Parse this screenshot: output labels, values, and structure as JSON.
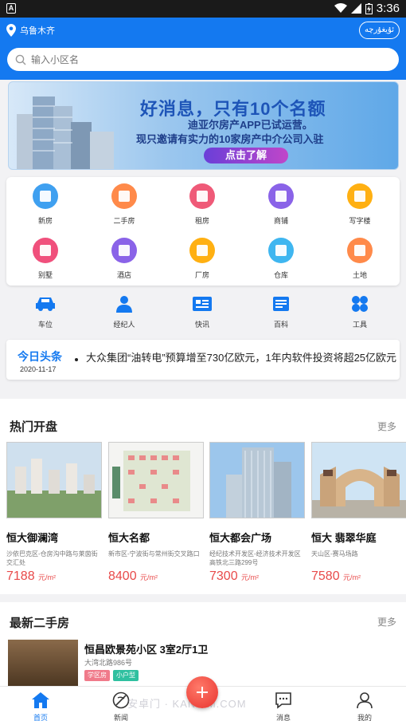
{
  "status": {
    "time": "3:36",
    "a_badge": "A"
  },
  "header": {
    "city": "乌鲁木齐",
    "lang_button": "ئۇيغۇرچە",
    "search_placeholder": "输入小区名"
  },
  "banner": {
    "title": "好消息，只有10个名额",
    "line1": "迪亚尔房产APP已试运营。",
    "line2": "现只邀请有实力的10家房产中介公司入驻",
    "button": "点击了解"
  },
  "categories": [
    {
      "label": "新房",
      "icon": "new-house-icon",
      "color": "#3fa0f0"
    },
    {
      "label": "二手房",
      "icon": "second-hand-house-icon",
      "color": "#ff8a4a"
    },
    {
      "label": "租房",
      "icon": "rent-icon",
      "color": "#ef5a78"
    },
    {
      "label": "商铺",
      "icon": "shop-icon",
      "color": "#8a63e8"
    },
    {
      "label": "写字楼",
      "icon": "office-icon",
      "color": "#ffb012"
    },
    {
      "label": "别墅",
      "icon": "villa-icon",
      "color": "#f0507c"
    },
    {
      "label": "酒店",
      "icon": "hotel-icon",
      "color": "#8a63e8"
    },
    {
      "label": "厂房",
      "icon": "factory-icon",
      "color": "#ffb012"
    },
    {
      "label": "仓库",
      "icon": "warehouse-icon",
      "color": "#3fb6f0"
    },
    {
      "label": "土地",
      "icon": "land-icon",
      "color": "#ff8a4a"
    }
  ],
  "tools": [
    {
      "label": "车位",
      "icon": "car-icon"
    },
    {
      "label": "经纪人",
      "icon": "agent-icon"
    },
    {
      "label": "快讯",
      "icon": "news-flash-icon"
    },
    {
      "label": "百科",
      "icon": "encyclopedia-icon"
    },
    {
      "label": "工具",
      "icon": "tools-icon"
    }
  ],
  "headline": {
    "title": "今日头条",
    "date": "2020-11-17",
    "news": "大众集团“油转电”预算增至730亿欧元，1年内软件投资将超25亿欧元"
  },
  "hot": {
    "title": "热门开盘",
    "more": "更多",
    "items": [
      {
        "name": "恒大御澜湾",
        "addr": "沙依巴克区-仓房沟中路与莱茵街交汇处",
        "price": "7188",
        "unit": "元/m²"
      },
      {
        "name": "恒大名都",
        "addr": "新市区-宁波街与常州街交叉路口",
        "price": "8400",
        "unit": "元/m²"
      },
      {
        "name": "恒大都会广场",
        "addr": "经纪技术开发区-经济技术开发区高铁北三路299号",
        "price": "7300",
        "unit": "元/m²"
      },
      {
        "name": "恒大 翡翠华庭",
        "addr": "天山区-赛马场路",
        "price": "7580",
        "unit": "元/m²"
      }
    ]
  },
  "second_hand": {
    "title": "最新二手房",
    "more": "更多",
    "item": {
      "title": "恒昌欧景苑小区  3室2厅1卫",
      "addr": "大湾北路986号",
      "tags": [
        "学区房",
        "小户型"
      ],
      "tag_colors": [
        "#f07a8a",
        "#2fc0a0"
      ]
    }
  },
  "tabbar": {
    "tabs": [
      {
        "label": "首页",
        "icon": "home-icon"
      },
      {
        "label": "新闻",
        "icon": "news-icon"
      },
      {
        "label": "消息",
        "icon": "message-icon"
      },
      {
        "label": "我的",
        "icon": "profile-icon"
      }
    ],
    "watermark": "安卓门 · KAN ZM.COM"
  }
}
